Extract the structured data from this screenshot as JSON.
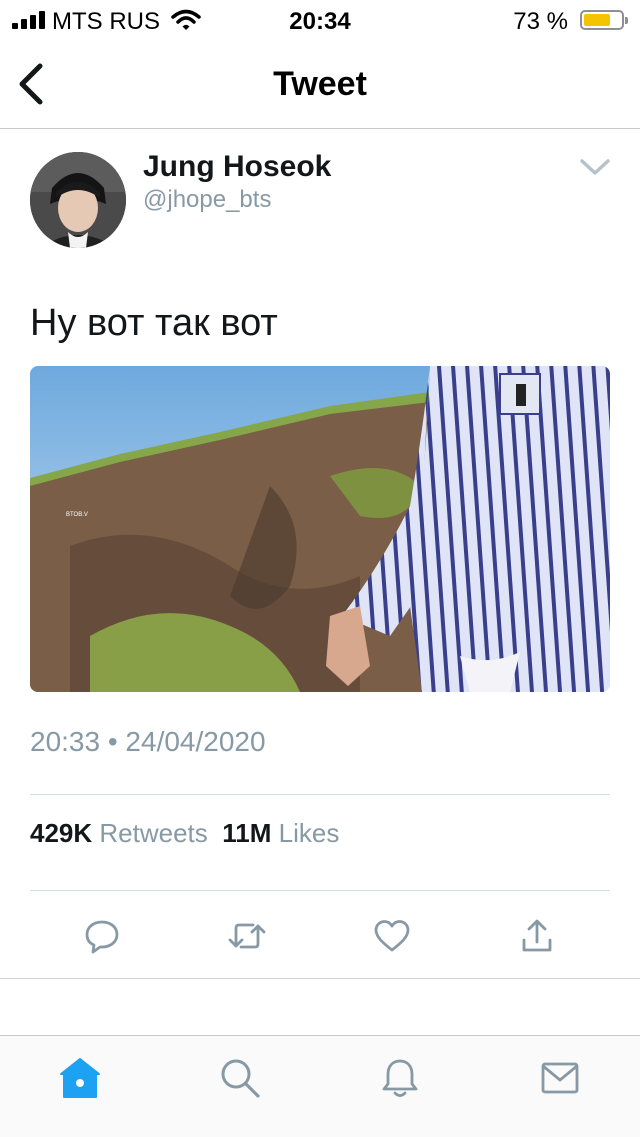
{
  "status_bar": {
    "carrier": "MTS RUS",
    "time": "20:34",
    "battery_percent": "73 %",
    "battery_level": 0.73,
    "battery_color": "#f5c400"
  },
  "nav": {
    "title": "Tweet",
    "back_icon": "chevron-left-icon"
  },
  "tweet": {
    "author_name": "Jung Hoseok",
    "author_handle": "@jhope_bts",
    "text": "Ну вот так вот",
    "timestamp": "20:33 • 24/04/2020",
    "media_watermark": "BTOB.V",
    "stats": {
      "retweets_count": "429K",
      "retweets_label": "Retweets",
      "likes_count": "11M",
      "likes_label": "Likes"
    }
  },
  "actions": [
    {
      "name": "reply",
      "icon": "reply-bubble-icon"
    },
    {
      "name": "retweet",
      "icon": "retweet-icon"
    },
    {
      "name": "like",
      "icon": "heart-icon"
    },
    {
      "name": "share",
      "icon": "share-icon"
    }
  ],
  "tab_bar": [
    {
      "name": "home",
      "icon": "home-icon",
      "active": true
    },
    {
      "name": "search",
      "icon": "search-icon",
      "active": false
    },
    {
      "name": "notifications",
      "icon": "bell-icon",
      "active": false
    },
    {
      "name": "messages",
      "icon": "mail-icon",
      "active": false
    }
  ],
  "colors": {
    "accent": "#1da1f2",
    "icon_gray": "#8899a6",
    "text": "#14171a"
  }
}
